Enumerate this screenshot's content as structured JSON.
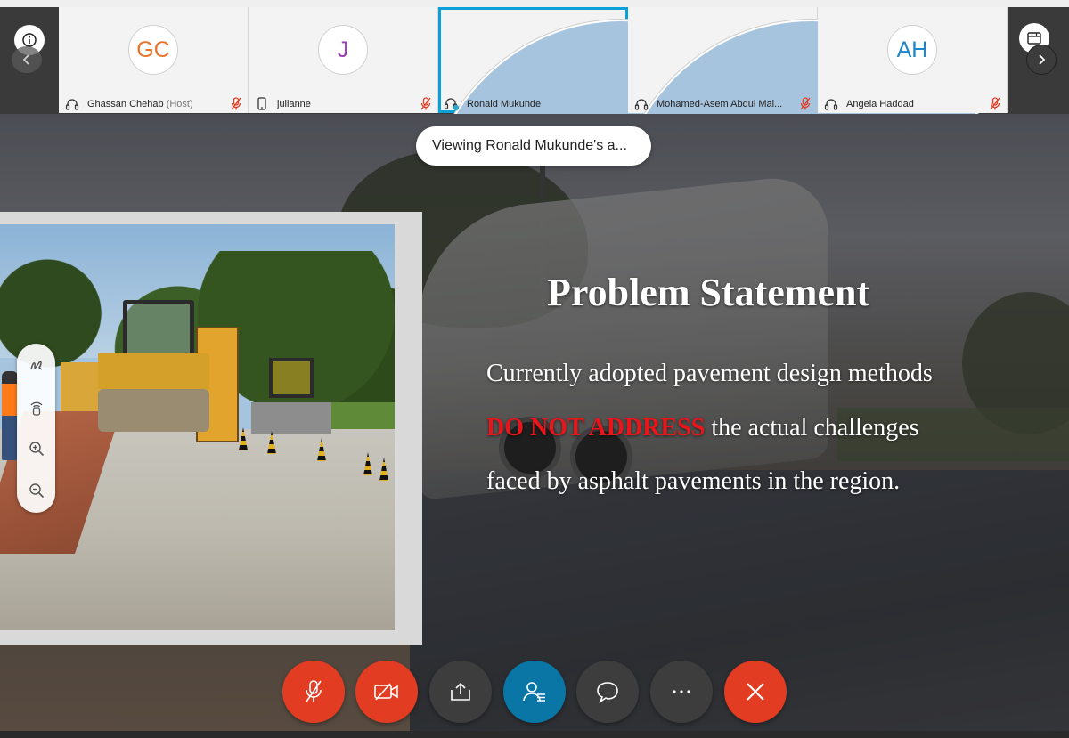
{
  "participants": [
    {
      "initials": "GC",
      "name": "Ghassan Chehab",
      "host_label": "(Host)",
      "initials_color": "#e8742b",
      "device": "headset-icon",
      "muted": true
    },
    {
      "initials": "J",
      "name": "julianne",
      "host_label": "",
      "initials_color": "#9a3fb0",
      "device": "phone-icon",
      "muted": true
    },
    {
      "initials": "",
      "name": "Ronald Mukunde",
      "host_label": "",
      "active": true,
      "device": "headset-speaking-icon",
      "muted": false
    },
    {
      "initials": "",
      "name": "Mohamed-Asem Abdul Mal...",
      "host_label": "",
      "device": "headset-icon",
      "muted": true
    },
    {
      "initials": "AH",
      "name": "Angela Haddad",
      "host_label": "",
      "initials_color": "#1f86c9",
      "device": "headset-icon",
      "muted": true
    }
  ],
  "toast": "Viewing Ronald Mukunde's a...",
  "slide": {
    "title": "Problem Statement",
    "body_part1": "Currently adopted pavement design methods",
    "body_emphasis": "DO NOT ADDRESS",
    "body_part2": "the actual challenges faced by asphalt pavements in the region."
  },
  "controls": [
    {
      "name": "mute-button",
      "icon": "mic-off-icon",
      "color": "#e23d23"
    },
    {
      "name": "stop-video-button",
      "icon": "video-off-icon",
      "color": "#e23d23"
    },
    {
      "name": "share-button",
      "icon": "share-icon",
      "color": "#3d3d3d"
    },
    {
      "name": "participants-button",
      "icon": "participants-icon",
      "color": "#0a76a6"
    },
    {
      "name": "chat-button",
      "icon": "chat-icon",
      "color": "#3d3d3d"
    },
    {
      "name": "more-options-button",
      "icon": "more-icon",
      "color": "#3d3d3d"
    },
    {
      "name": "leave-meeting-button",
      "icon": "close-icon",
      "color": "#e23d23"
    }
  ],
  "colors": {
    "active_tile_border": "#0aa0d8",
    "emphasis_red": "#e8161b"
  }
}
